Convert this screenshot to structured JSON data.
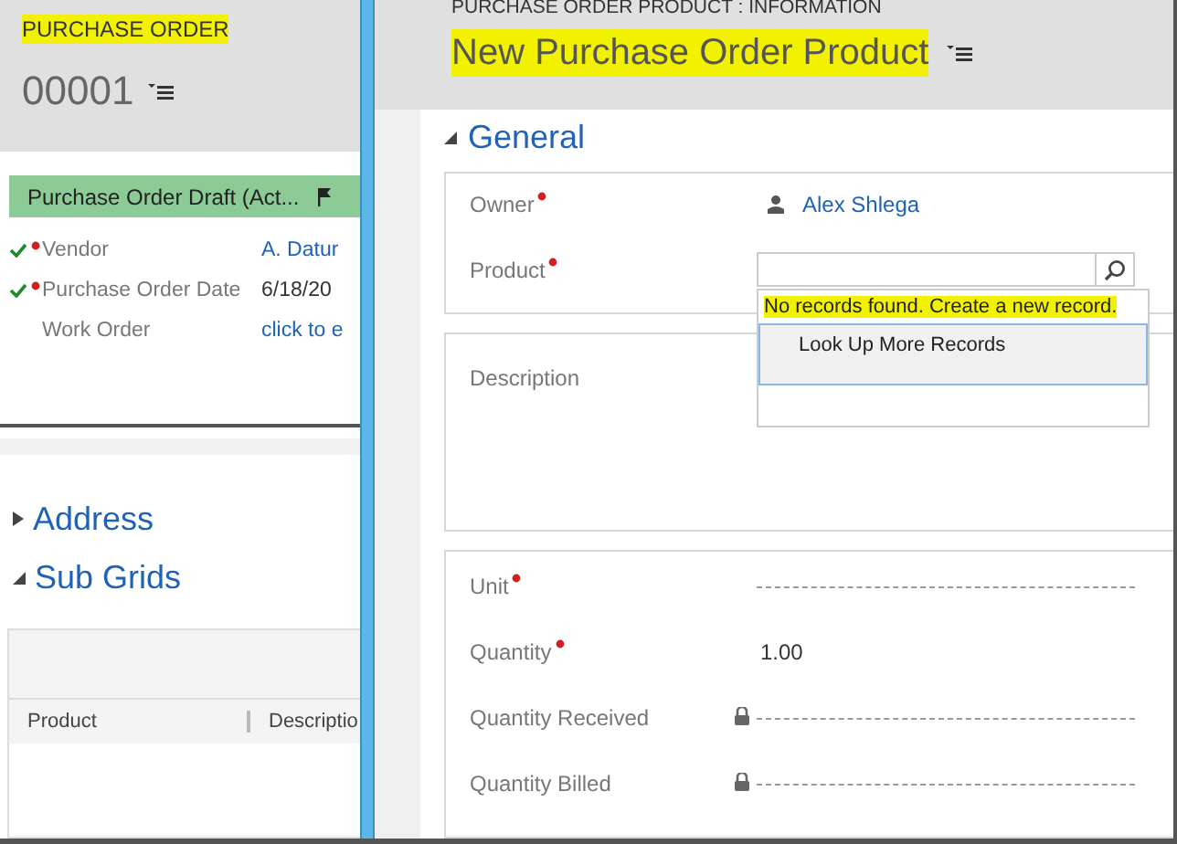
{
  "left": {
    "entity_type": {
      "text": "PURCHASE ORDER",
      "highlighted": true
    },
    "record_name": "00001",
    "process_stage": "Purchase Order Draft (Act...",
    "fields": [
      {
        "label": "Vendor",
        "required": true,
        "completed": true,
        "kind": "link",
        "value": "A. Datur"
      },
      {
        "label": "Purchase Order Date",
        "required": true,
        "completed": true,
        "kind": "text",
        "value": "6/18/20"
      },
      {
        "label": "Work Order",
        "required": false,
        "completed": false,
        "kind": "link",
        "value": "click to e"
      }
    ],
    "sections": [
      {
        "title": "Address",
        "expanded": false
      },
      {
        "title": "Sub Grids",
        "expanded": true
      }
    ],
    "subgrid": {
      "columns": [
        "Product",
        "Descriptio"
      ]
    }
  },
  "right": {
    "form_header": "PURCHASE ORDER PRODUCT : INFORMATION",
    "title": {
      "text": "New Purchase Order Product",
      "highlighted": true
    },
    "section": {
      "title": "General",
      "expanded": true
    },
    "groups": [
      {
        "fields": [
          {
            "label": "Owner",
            "required": true,
            "kind": "user",
            "value": "Alex Shlega"
          },
          {
            "label": "Product",
            "required": true,
            "kind": "lookup"
          }
        ]
      },
      {
        "fields": [
          {
            "label": "Description",
            "required": false,
            "kind": "multiline"
          }
        ]
      },
      {
        "fields": [
          {
            "label": "Unit",
            "required": true,
            "kind": "empty"
          },
          {
            "label": "Quantity",
            "required": true,
            "kind": "text",
            "value": "1.00"
          },
          {
            "label": "Quantity Received",
            "required": false,
            "kind": "locked"
          },
          {
            "label": "Quantity Billed",
            "required": false,
            "kind": "locked"
          }
        ]
      }
    ],
    "lookup_flyout": {
      "message": {
        "text": "No records found. Create a new record.",
        "highlighted": true
      },
      "items": [
        {
          "label": "Look Up More Records",
          "selected": true
        }
      ]
    }
  }
}
